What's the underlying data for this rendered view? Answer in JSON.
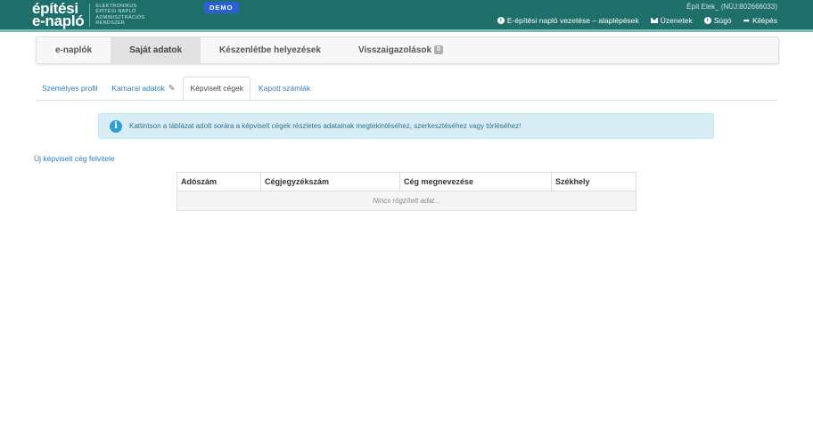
{
  "header": {
    "logo_line1": "építési",
    "logo_line2": "e-napló",
    "logo_sub1": "ELEKTRONIKUS",
    "logo_sub2": "ÉPÍTÉSI NAPLÓ",
    "logo_sub3": "ADMINISZTRÁCIÓS",
    "logo_sub4": "RENDSZER",
    "demo_badge": "DEMO",
    "user_label": "Épít Elek_ (NÜJ:802666033)",
    "links": {
      "guide": "E-építési napló vezetése – alaplépések",
      "messages": "Üzenetek",
      "help": "Súgó",
      "logout": "Kilépés"
    },
    "colors": {
      "bar": "#1e6e6a",
      "demo": "#2b5fd6"
    }
  },
  "main_nav": {
    "items": [
      {
        "label": "e-naplók"
      },
      {
        "label": "Saját adatok"
      },
      {
        "label": "Készenlétbe helyezések"
      },
      {
        "label": "Visszaigazolások",
        "badge": "0"
      }
    ],
    "active": "Saját adatok"
  },
  "sub_tabs": {
    "items": [
      {
        "label": "Személyes profil"
      },
      {
        "label": "Kamarai adatok"
      },
      {
        "label": "Képviselt cégek"
      },
      {
        "label": "Kapott számlák"
      }
    ],
    "active": "Képviselt cégek"
  },
  "info_alert": {
    "text": "Kattintson a táblázat adott sorára a képviselt cégek részletes adatainak megtekintéséhez, szerkesztéséhez vagy törléséhez!",
    "color": "#d9edf7"
  },
  "new_company_link": "Új képviselt cég felvitele",
  "table": {
    "columns": [
      "Adószám",
      "Cégjegyzékszám",
      "Cég megnevezése",
      "Székhely"
    ],
    "empty_text": "Nincs rögzített adat..."
  }
}
